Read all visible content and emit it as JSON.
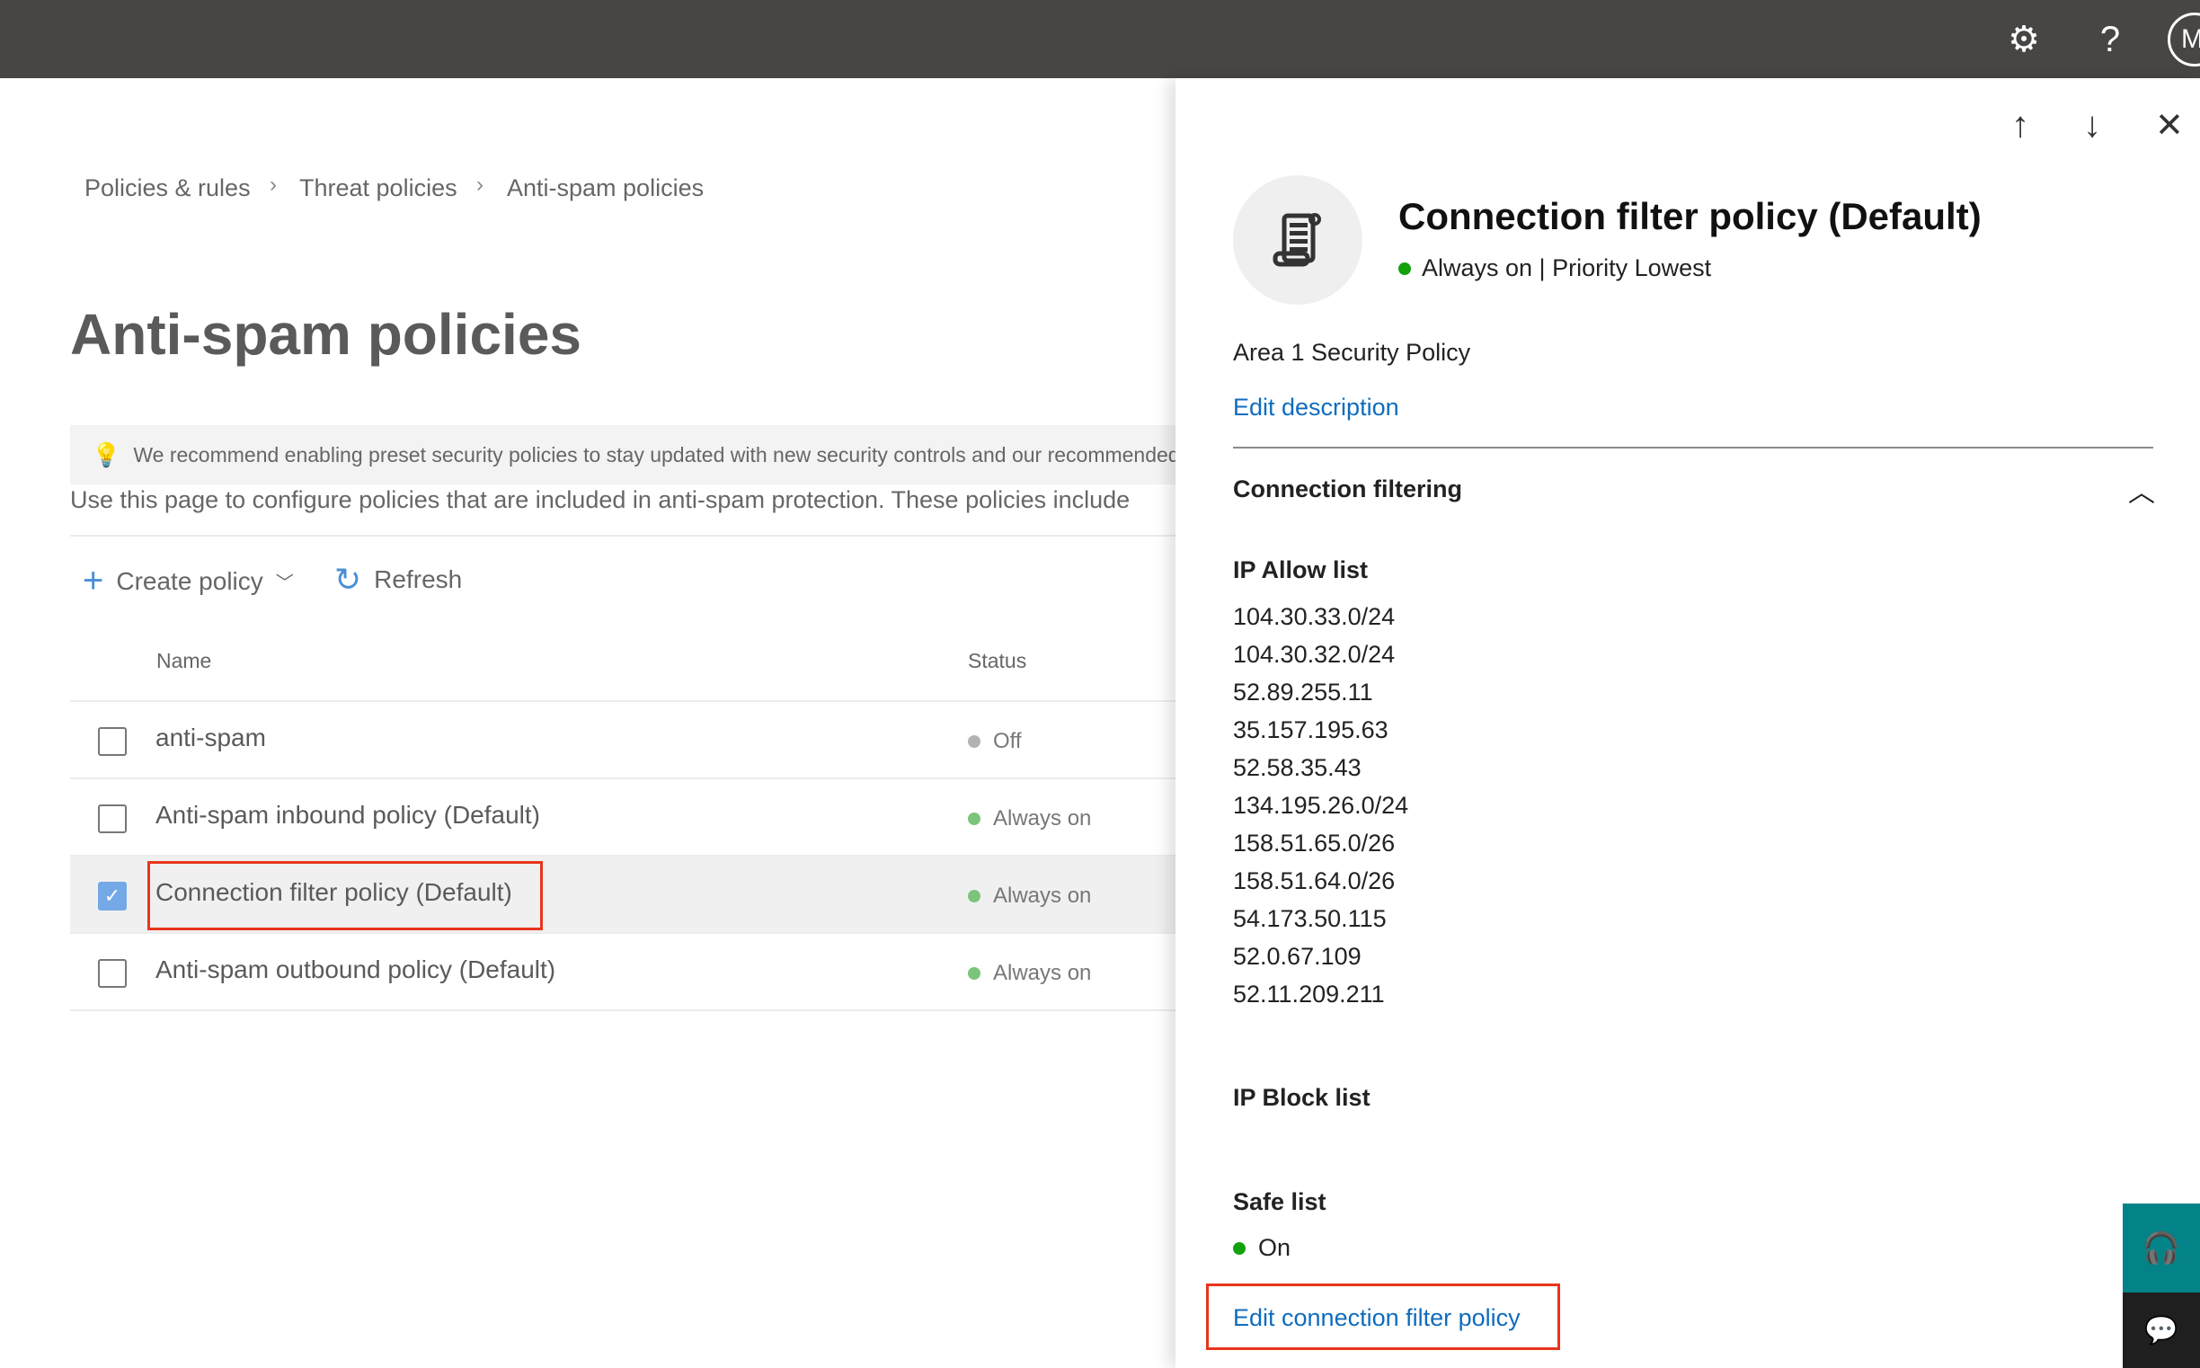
{
  "topbar": {
    "settings_icon": "gear-icon",
    "help_icon": "question-icon",
    "avatar_initial": "M"
  },
  "breadcrumb": [
    "Policies & rules",
    "Threat policies",
    "Anti-spam policies"
  ],
  "page": {
    "title": "Anti-spam policies",
    "banner": "We recommend enabling preset security policies to stay updated with new security controls and our recommended settings.",
    "description": "Use this page to configure policies that are included in anti-spam protection. These policies include",
    "toolbar": {
      "create": "Create policy",
      "refresh": "Refresh"
    },
    "columns": {
      "name": "Name",
      "status": "Status"
    },
    "rows": [
      {
        "name": "anti-spam",
        "status": "Off",
        "checked": false,
        "status_color": "#b3b3b3"
      },
      {
        "name": "Anti-spam inbound policy (Default)",
        "status": "Always on",
        "checked": false,
        "status_color": "#7cc47c"
      },
      {
        "name": "Connection filter policy (Default)",
        "status": "Always on",
        "checked": true,
        "status_color": "#7cc47c"
      },
      {
        "name": "Anti-spam outbound policy (Default)",
        "status": "Always on",
        "checked": false,
        "status_color": "#7cc47c"
      }
    ]
  },
  "panel": {
    "title": "Connection filter policy (Default)",
    "status": "Always on | Priority Lowest",
    "description": "Area 1 Security Policy",
    "edit_description": "Edit description",
    "section": "Connection filtering",
    "ip_allow_label": "IP Allow list",
    "ip_allow": [
      "104.30.33.0/24",
      "104.30.32.0/24",
      "52.89.255.11",
      "35.157.195.63",
      "52.58.35.43",
      "134.195.26.0/24",
      "158.51.65.0/26",
      "158.51.64.0/26",
      "54.173.50.115",
      "52.0.67.109",
      "52.11.209.211"
    ],
    "ip_block_label": "IP Block list",
    "safe_list_label": "Safe list",
    "safe_list_value": "On",
    "edit_link": "Edit connection filter policy"
  },
  "colors": {
    "accent": "#0f6cbd",
    "on_green": "#13a10e",
    "topbar": "#484644",
    "highlight": "#e8341c",
    "teal": "#038387"
  }
}
